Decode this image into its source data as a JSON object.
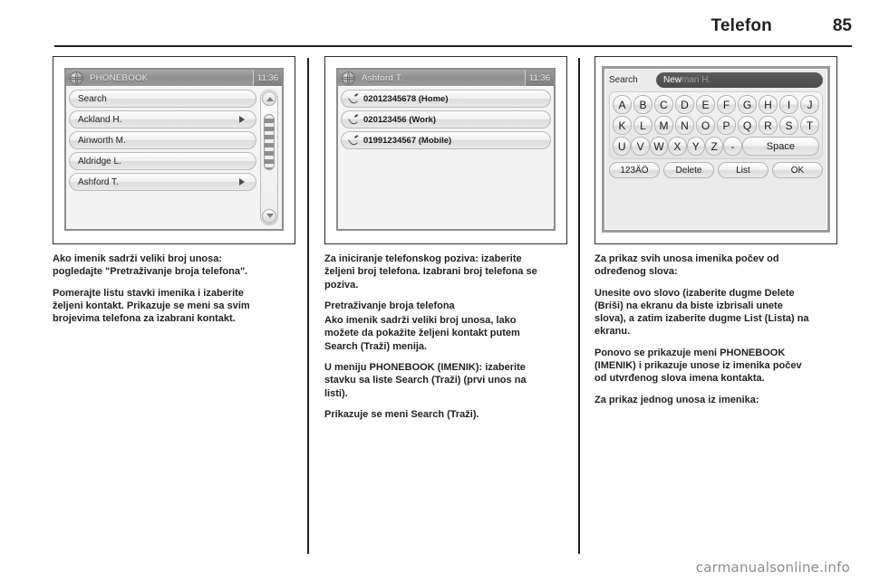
{
  "header": {
    "title": "Telefon",
    "page_number": "85"
  },
  "figures": {
    "phonebook": {
      "titlebar": {
        "icon": "globe-icon",
        "title": "PHONEBOOK",
        "clock": "11:36"
      },
      "rows": [
        {
          "label": "Search",
          "arrow": false
        },
        {
          "label": "Ackland H.",
          "arrow": true
        },
        {
          "label": "Ainworth M.",
          "arrow": false
        },
        {
          "label": "Aldridge L.",
          "arrow": false
        },
        {
          "label": "Ashford T.",
          "arrow": true
        }
      ],
      "scrollbar": {
        "up": "chevron-up-icon",
        "down": "chevron-down-icon"
      }
    },
    "contact": {
      "titlebar": {
        "icon": "globe-icon",
        "title": "Ashford T.",
        "clock": "11:36"
      },
      "numbers": [
        "02012345678 (Home)",
        "020123456 (Work)",
        "01991234567 (Mobile)"
      ]
    },
    "keyboard": {
      "search_label": "Search",
      "typed_text": "New",
      "ghost_text": "man H.",
      "rows": [
        [
          "A",
          "B",
          "C",
          "D",
          "E",
          "F",
          "G",
          "H",
          "I",
          "J"
        ],
        [
          "K",
          "L",
          "M",
          "N",
          "O",
          "P",
          "Q",
          "R",
          "S",
          "T"
        ],
        [
          "U",
          "V",
          "W",
          "X",
          "Y",
          "Z",
          "-"
        ]
      ],
      "space_key": "Space",
      "function_keys": [
        "123ÄÖ",
        "Delete",
        "List",
        "OK"
      ]
    }
  },
  "columns": {
    "c1": [
      "Ako imenik sadrži veliki broj unosa: pogledajte \"Pretraživanje broja telefona\".",
      "Pomerajte listu stavki imenika i izaberite željeni kontakt. Prikazuje se meni sa svim brojevima telefona za izabrani kontakt."
    ],
    "c2": [
      "Za iniciranje telefonskog poziva: izaberite željeni broj telefona. Izabrani broj telefona se poziva.",
      "Pretraživanje broja telefona",
      "Ako imenik sadrži veliki broj unosa, lako možete da pokažite željeni kontakt putem Search (Traži) menija.",
      "U meniju PHONEBOOK (IMENIK): izaberite stavku sa liste Search (Traži) (prvi unos na listi).",
      "Prikazuje se meni Search (Traži)."
    ],
    "c3": [
      "Za prikaz svih unosa imenika počev od određenog slova:",
      "Unesite ovo slovo (izaberite dugme Delete (Briši) na ekranu da biste izbrisali unete slova), a zatim izaberite dugme List (Lista) na ekranu.",
      "Ponovo se prikazuje meni PHONEBOOK (IMENIK) i prikazuje unose iz imenika počev od utvrđenog slova imena kontakta.",
      "Za prikaz jednog unosa iz imenika:"
    ]
  },
  "watermark": "carmanualsonline.info"
}
